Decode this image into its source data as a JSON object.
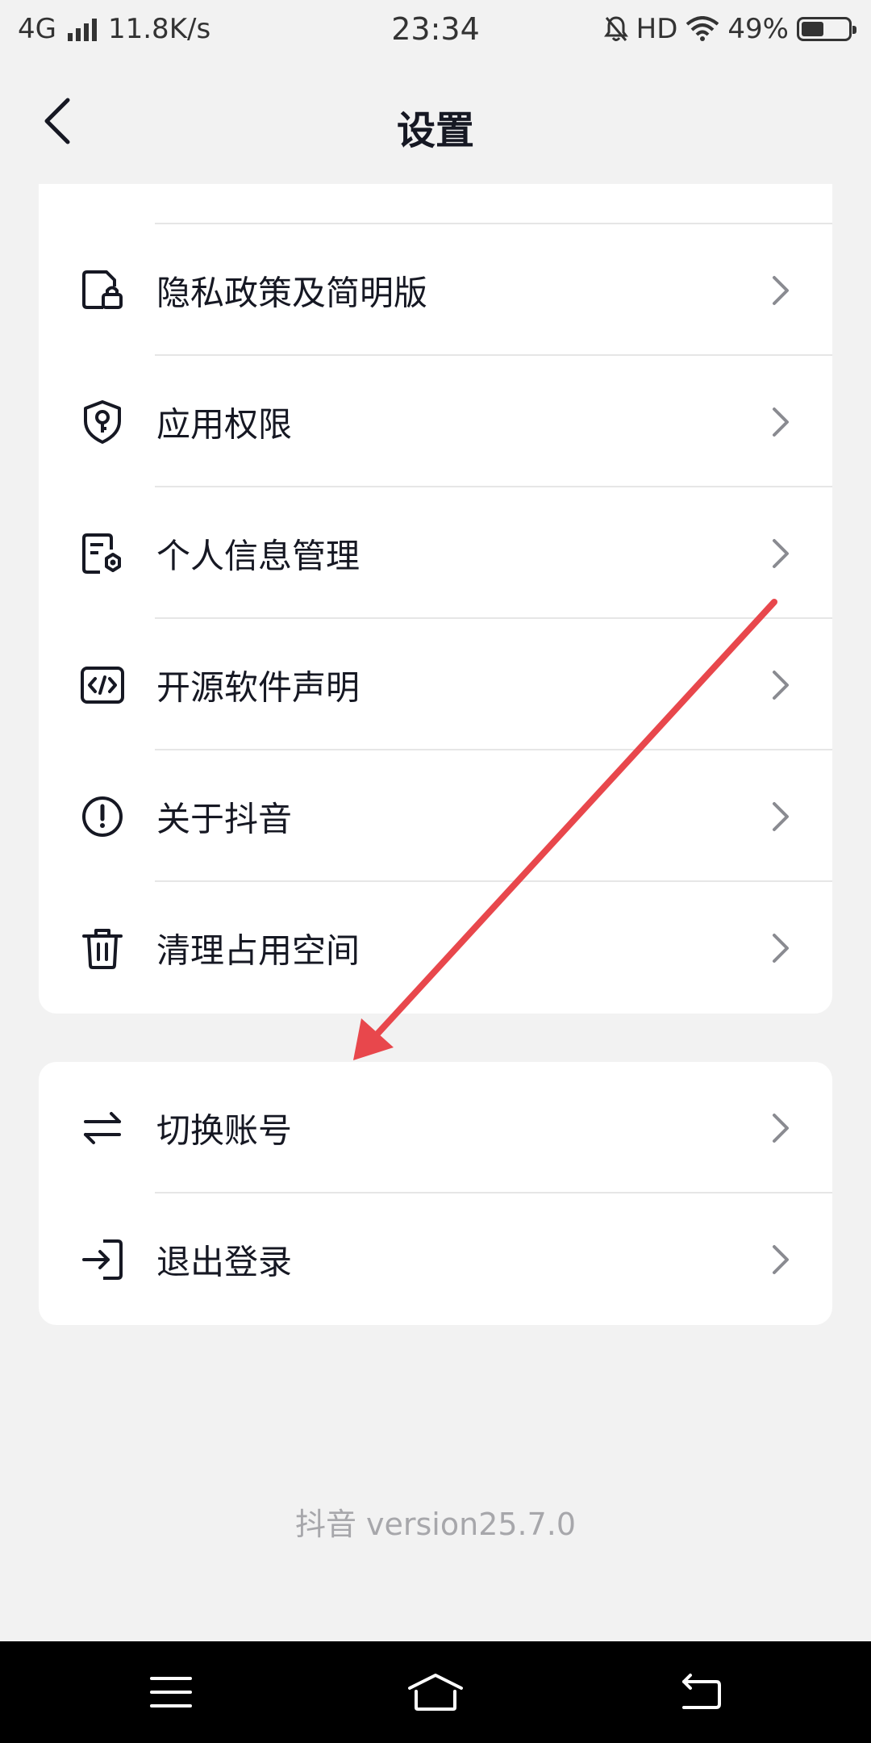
{
  "status_bar": {
    "network": "4G",
    "speed": "11.8K/s",
    "time": "23:34",
    "hd": "HD",
    "battery": "49%",
    "battery_level": 0.49
  },
  "header": {
    "title": "设置"
  },
  "menu_group_1": [
    {
      "label": "隐私政策及简明版",
      "icon": "document-lock-icon"
    },
    {
      "label": "应用权限",
      "icon": "shield-key-icon"
    },
    {
      "label": "个人信息管理",
      "icon": "document-gear-icon"
    },
    {
      "label": "开源软件声明",
      "icon": "code-icon"
    },
    {
      "label": "关于抖音",
      "icon": "info-circle-icon"
    },
    {
      "label": "清理占用空间",
      "icon": "trash-icon"
    }
  ],
  "menu_group_2": [
    {
      "label": "切换账号",
      "icon": "switch-arrows-icon"
    },
    {
      "label": "退出登录",
      "icon": "logout-icon"
    }
  ],
  "footer": {
    "version": "抖音 version25.7.0"
  },
  "colors": {
    "annotation_arrow": "#e8474c",
    "background": "#f2f2f2",
    "card": "#ffffff"
  }
}
